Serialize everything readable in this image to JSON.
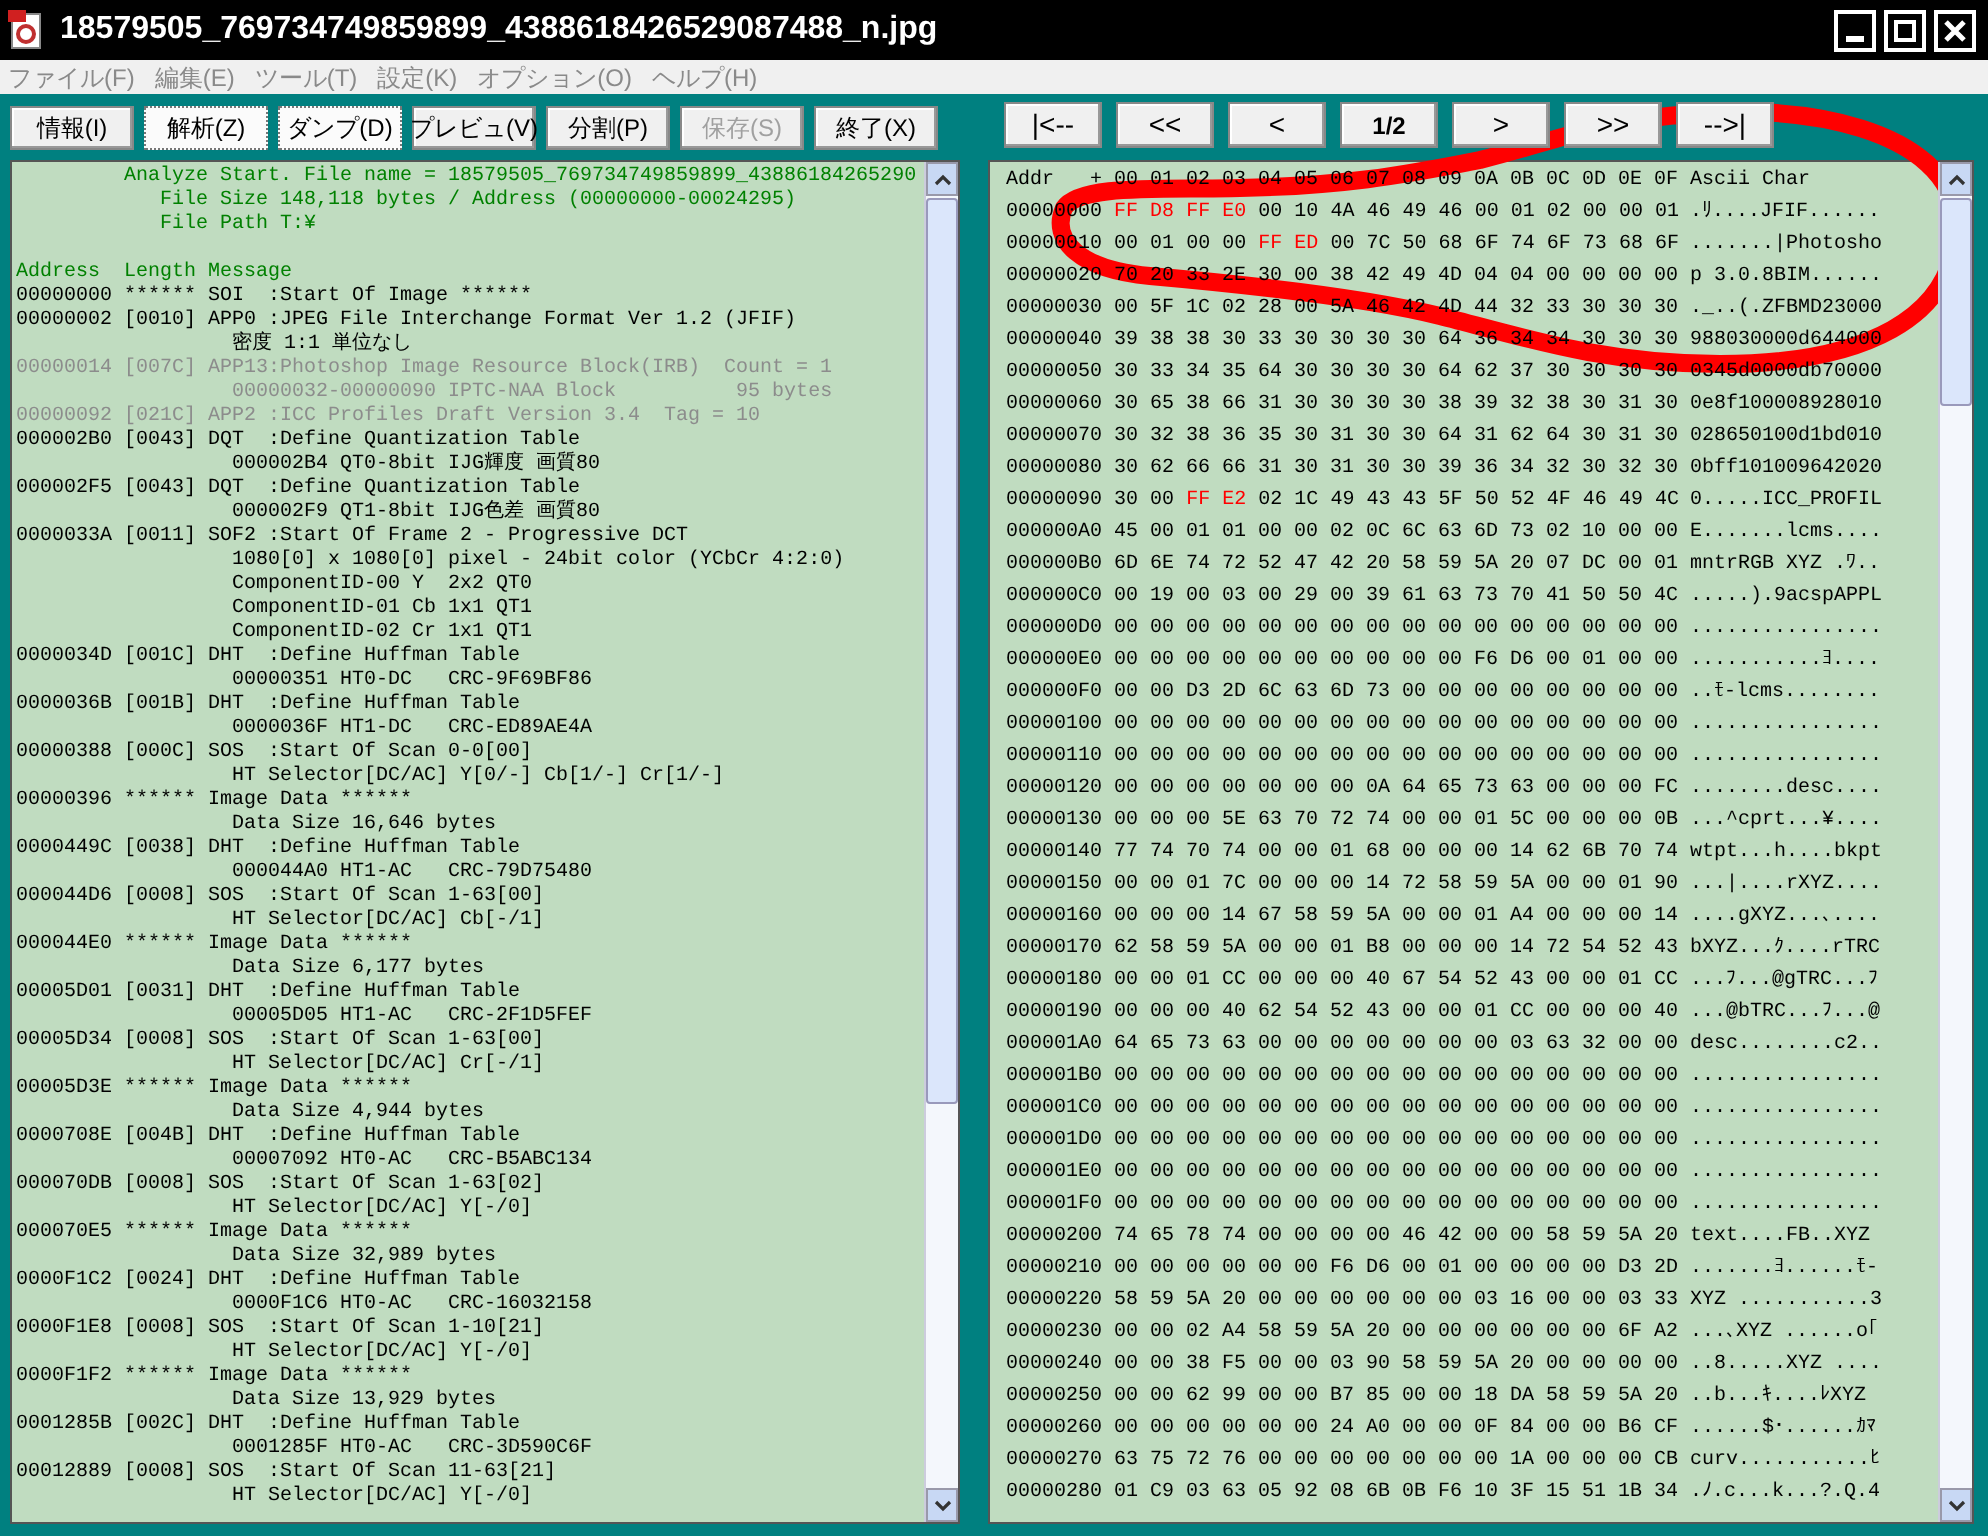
{
  "window": {
    "title": "18579505_769734749859899_4388618426529087488_n.jpg"
  },
  "menu": [
    "ファイル(F)",
    "編集(E)",
    "ツール(T)",
    "設定(K)",
    "オプション(O)",
    "ヘルプ(H)"
  ],
  "toolbar": [
    {
      "label": "情報(I)",
      "selected": false,
      "disabled": false
    },
    {
      "label": "解析(Z)",
      "selected": true,
      "disabled": false
    },
    {
      "label": "ダンプ(D)",
      "selected": true,
      "disabled": false
    },
    {
      "label": "プレビュ(V)",
      "selected": false,
      "disabled": false
    },
    {
      "label": "分割(P)",
      "selected": false,
      "disabled": false
    },
    {
      "label": "保存(S)",
      "selected": false,
      "disabled": true
    },
    {
      "label": "終了(X)",
      "selected": false,
      "disabled": false
    }
  ],
  "navigation": [
    {
      "label": "|<--",
      "kind": "nav"
    },
    {
      "label": "<<",
      "kind": "nav"
    },
    {
      "label": "<",
      "kind": "nav"
    },
    {
      "label": "1/2",
      "kind": "page"
    },
    {
      "label": ">",
      "kind": "nav"
    },
    {
      "label": ">>",
      "kind": "nav"
    },
    {
      "label": "-->|",
      "kind": "nav"
    }
  ],
  "analysis": {
    "header": [
      {
        "kind": "title",
        "text": "Analyze Start. File name = 18579505_769734749859899_43886184265290"
      },
      {
        "kind": "sub",
        "text": "File Size 148,118 bytes / Address (00000000-00024295)"
      },
      {
        "kind": "sub",
        "text": "File Path T:¥"
      }
    ],
    "columns": [
      "Address",
      "Length",
      "Message"
    ],
    "entries": [
      {
        "address": "00000000",
        "length": "******",
        "message": "SOI  :Start Of Image ******",
        "muted": false
      },
      {
        "address": "00000002",
        "length": "[0010]",
        "message": "APP0 :JPEG File Interchange Format Ver 1.2 (JFIF)",
        "muted": false,
        "details": [
          "密度 1:1 単位なし"
        ]
      },
      {
        "address": "00000014",
        "length": "[007C]",
        "message": "APP13:Photoshop Image Resource Block(IRB)  Count = 1",
        "muted": true,
        "details": [
          "00000032-00000090 IPTC-NAA Block          95 bytes"
        ]
      },
      {
        "address": "00000092",
        "length": "[021C]",
        "message": "APP2 :ICC Profiles Draft Version 3.4  Tag = 10",
        "muted": true
      },
      {
        "address": "000002B0",
        "length": "[0043]",
        "message": "DQT  :Define Quantization Table",
        "muted": false,
        "details": [
          "000002B4 QT0-8bit IJG輝度 画質80"
        ]
      },
      {
        "address": "000002F5",
        "length": "[0043]",
        "message": "DQT  :Define Quantization Table",
        "muted": false,
        "details": [
          "000002F9 QT1-8bit IJG色差 画質80"
        ]
      },
      {
        "address": "0000033A",
        "length": "[0011]",
        "message": "SOF2 :Start Of Frame 2 - Progressive DCT",
        "muted": false,
        "details": [
          "1080[0] x 1080[0] pixel - 24bit color (YCbCr 4:2:0)",
          "ComponentID-00 Y  2x2 QT0",
          "ComponentID-01 Cb 1x1 QT1",
          "ComponentID-02 Cr 1x1 QT1"
        ]
      },
      {
        "address": "0000034D",
        "length": "[001C]",
        "message": "DHT  :Define Huffman Table",
        "muted": false,
        "details": [
          "00000351 HT0-DC   CRC-9F69BF86"
        ]
      },
      {
        "address": "0000036B",
        "length": "[001B]",
        "message": "DHT  :Define Huffman Table",
        "muted": false,
        "details": [
          "0000036F HT1-DC   CRC-ED89AE4A"
        ]
      },
      {
        "address": "00000388",
        "length": "[000C]",
        "message": "SOS  :Start Of Scan 0-0[00]",
        "muted": false,
        "details": [
          "HT Selector[DC/AC] Y[0/-] Cb[1/-] Cr[1/-]"
        ]
      },
      {
        "address": "00000396",
        "length": "******",
        "message": "Image Data ******",
        "muted": false,
        "details": [
          "Data Size 16,646 bytes"
        ]
      },
      {
        "address": "0000449C",
        "length": "[0038]",
        "message": "DHT  :Define Huffman Table",
        "muted": false,
        "details": [
          "000044A0 HT1-AC   CRC-79D75480"
        ]
      },
      {
        "address": "000044D6",
        "length": "[0008]",
        "message": "SOS  :Start Of Scan 1-63[00]",
        "muted": false,
        "details": [
          "HT Selector[DC/AC] Cb[-/1]"
        ]
      },
      {
        "address": "000044E0",
        "length": "******",
        "message": "Image Data ******",
        "muted": false,
        "details": [
          "Data Size 6,177 bytes"
        ]
      },
      {
        "address": "00005D01",
        "length": "[0031]",
        "message": "DHT  :Define Huffman Table",
        "muted": false,
        "details": [
          "00005D05 HT1-AC   CRC-2F1D5FEF"
        ]
      },
      {
        "address": "00005D34",
        "length": "[0008]",
        "message": "SOS  :Start Of Scan 1-63[00]",
        "muted": false,
        "details": [
          "HT Selector[DC/AC] Cr[-/1]"
        ]
      },
      {
        "address": "00005D3E",
        "length": "******",
        "message": "Image Data ******",
        "muted": false,
        "details": [
          "Data Size 4,944 bytes"
        ]
      },
      {
        "address": "0000708E",
        "length": "[004B]",
        "message": "DHT  :Define Huffman Table",
        "muted": false,
        "details": [
          "00007092 HT0-AC   CRC-B5ABC134"
        ]
      },
      {
        "address": "000070DB",
        "length": "[0008]",
        "message": "SOS  :Start Of Scan 1-63[02]",
        "muted": false,
        "details": [
          "HT Selector[DC/AC] Y[-/0]"
        ]
      },
      {
        "address": "000070E5",
        "length": "******",
        "message": "Image Data ******",
        "muted": false,
        "details": [
          "Data Size 32,989 bytes"
        ]
      },
      {
        "address": "0000F1C2",
        "length": "[0024]",
        "message": "DHT  :Define Huffman Table",
        "muted": false,
        "details": [
          "0000F1C6 HT0-AC   CRC-16032158"
        ]
      },
      {
        "address": "0000F1E8",
        "length": "[0008]",
        "message": "SOS  :Start Of Scan 1-10[21]",
        "muted": false,
        "details": [
          "HT Selector[DC/AC] Y[-/0]"
        ]
      },
      {
        "address": "0000F1F2",
        "length": "******",
        "message": "Image Data ******",
        "muted": false,
        "details": [
          "Data Size 13,929 bytes"
        ]
      },
      {
        "address": "0001285B",
        "length": "[002C]",
        "message": "DHT  :Define Huffman Table",
        "muted": false,
        "details": [
          "0001285F HT0-AC   CRC-3D590C6F"
        ]
      },
      {
        "address": "00012889",
        "length": "[0008]",
        "message": "SOS  :Start Of Scan 11-63[21]",
        "muted": false,
        "details": [
          "HT Selector[DC/AC] Y[-/0]"
        ]
      }
    ]
  },
  "hex": {
    "header": {
      "addr": "Addr",
      "offset": "+",
      "columns": "00 01 02 03 04 05 06 07 08 09 0A 0B 0C 0D 0E 0F",
      "ascii": "Ascii Char"
    },
    "rows": [
      {
        "addr": "00000000",
        "bytes": "FF D8 FF E0 00 10 4A 46 49 46 00 01 02 00 00 01",
        "ascii": ".ﾘ....JFIF......",
        "marked": [
          true,
          true,
          true,
          true,
          false,
          false,
          false,
          false,
          false,
          false,
          false,
          false,
          false,
          false,
          false,
          false
        ]
      },
      {
        "addr": "00000010",
        "bytes": "00 01 00 00 FF ED 00 7C 50 68 6F 74 6F 73 68 6F",
        "ascii": ".......|Photosho",
        "marked": [
          false,
          false,
          false,
          false,
          true,
          true,
          false,
          false,
          false,
          false,
          false,
          false,
          false,
          false,
          false,
          false
        ]
      },
      {
        "addr": "00000020",
        "bytes": "70 20 33 2E 30 00 38 42 49 4D 04 04 00 00 00 00",
        "ascii": "p 3.0.8BIM......"
      },
      {
        "addr": "00000030",
        "bytes": "00 5F 1C 02 28 00 5A 46 42 4D 44 32 33 30 30 30",
        "ascii": "._..(.ZFBMD23000"
      },
      {
        "addr": "00000040",
        "bytes": "39 38 38 30 33 30 30 30 30 64 36 34 34 30 30 30",
        "ascii": "988030000d644000"
      },
      {
        "addr": "00000050",
        "bytes": "30 33 34 35 64 30 30 30 30 64 62 37 30 30 30 30",
        "ascii": "0345d0000db70000"
      },
      {
        "addr": "00000060",
        "bytes": "30 65 38 66 31 30 30 30 30 38 39 32 38 30 31 30",
        "ascii": "0e8f100008928010"
      },
      {
        "addr": "00000070",
        "bytes": "30 32 38 36 35 30 31 30 30 64 31 62 64 30 31 30",
        "ascii": "028650100d1bd010"
      },
      {
        "addr": "00000080",
        "bytes": "30 62 66 66 31 30 31 30 30 39 36 34 32 30 32 30",
        "ascii": "0bff101009642020"
      },
      {
        "addr": "00000090",
        "bytes": "30 00 FF E2 02 1C 49 43 43 5F 50 52 4F 46 49 4C",
        "ascii": "0.....ICC_PROFIL",
        "marked": [
          false,
          false,
          true,
          true,
          false,
          false,
          false,
          false,
          false,
          false,
          false,
          false,
          false,
          false,
          false,
          false
        ]
      },
      {
        "addr": "000000A0",
        "bytes": "45 00 01 01 00 00 02 0C 6C 63 6D 73 02 10 00 00",
        "ascii": "E.......lcms...."
      },
      {
        "addr": "000000B0",
        "bytes": "6D 6E 74 72 52 47 42 20 58 59 5A 20 07 DC 00 01",
        "ascii": "mntrRGB XYZ .ﾜ.."
      },
      {
        "addr": "000000C0",
        "bytes": "00 19 00 03 00 29 00 39 61 63 73 70 41 50 50 4C",
        "ascii": ".....).9acspAPPL"
      },
      {
        "addr": "000000D0",
        "bytes": "00 00 00 00 00 00 00 00 00 00 00 00 00 00 00 00",
        "ascii": "................"
      },
      {
        "addr": "000000E0",
        "bytes": "00 00 00 00 00 00 00 00 00 00 F6 D6 00 01 00 00",
        "ascii": "...........ﾖ...."
      },
      {
        "addr": "000000F0",
        "bytes": "00 00 D3 2D 6C 63 6D 73 00 00 00 00 00 00 00 00",
        "ascii": "..ﾓ-lcms........"
      },
      {
        "addr": "00000100",
        "bytes": "00 00 00 00 00 00 00 00 00 00 00 00 00 00 00 00",
        "ascii": "................"
      },
      {
        "addr": "00000110",
        "bytes": "00 00 00 00 00 00 00 00 00 00 00 00 00 00 00 00",
        "ascii": "................"
      },
      {
        "addr": "00000120",
        "bytes": "00 00 00 00 00 00 00 0A 64 65 73 63 00 00 00 FC",
        "ascii": "........desc...."
      },
      {
        "addr": "00000130",
        "bytes": "00 00 00 5E 63 70 72 74 00 00 01 5C 00 00 00 0B",
        "ascii": "...^cprt...¥...."
      },
      {
        "addr": "00000140",
        "bytes": "77 74 70 74 00 00 01 68 00 00 00 14 62 6B 70 74",
        "ascii": "wtpt...h....bkpt"
      },
      {
        "addr": "00000150",
        "bytes": "00 00 01 7C 00 00 00 14 72 58 59 5A 00 00 01 90",
        "ascii": "...|....rXYZ...."
      },
      {
        "addr": "00000160",
        "bytes": "00 00 00 14 67 58 59 5A 00 00 01 A4 00 00 00 14",
        "ascii": "....gXYZ...､...."
      },
      {
        "addr": "00000170",
        "bytes": "62 58 59 5A 00 00 01 B8 00 00 00 14 72 54 52 43",
        "ascii": "bXYZ...ｸ....rTRC"
      },
      {
        "addr": "00000180",
        "bytes": "00 00 01 CC 00 00 00 40 67 54 52 43 00 00 01 CC",
        "ascii": "...ﾌ...@gTRC...ﾌ"
      },
      {
        "addr": "00000190",
        "bytes": "00 00 00 40 62 54 52 43 00 00 01 CC 00 00 00 40",
        "ascii": "...@bTRC...ﾌ...@"
      },
      {
        "addr": "000001A0",
        "bytes": "64 65 73 63 00 00 00 00 00 00 00 03 63 32 00 00",
        "ascii": "desc........c2.."
      },
      {
        "addr": "000001B0",
        "bytes": "00 00 00 00 00 00 00 00 00 00 00 00 00 00 00 00",
        "ascii": "................"
      },
      {
        "addr": "000001C0",
        "bytes": "00 00 00 00 00 00 00 00 00 00 00 00 00 00 00 00",
        "ascii": "................"
      },
      {
        "addr": "000001D0",
        "bytes": "00 00 00 00 00 00 00 00 00 00 00 00 00 00 00 00",
        "ascii": "................"
      },
      {
        "addr": "000001E0",
        "bytes": "00 00 00 00 00 00 00 00 00 00 00 00 00 00 00 00",
        "ascii": "................"
      },
      {
        "addr": "000001F0",
        "bytes": "00 00 00 00 00 00 00 00 00 00 00 00 00 00 00 00",
        "ascii": "................"
      },
      {
        "addr": "00000200",
        "bytes": "74 65 78 74 00 00 00 00 46 42 00 00 58 59 5A 20",
        "ascii": "text....FB..XYZ"
      },
      {
        "addr": "00000210",
        "bytes": "00 00 00 00 00 00 F6 D6 00 01 00 00 00 00 D3 2D",
        "ascii": ".......ﾖ......ﾓ-"
      },
      {
        "addr": "00000220",
        "bytes": "58 59 5A 20 00 00 00 00 00 00 03 16 00 00 03 33",
        "ascii": "XYZ ...........3"
      },
      {
        "addr": "00000230",
        "bytes": "00 00 02 A4 58 59 5A 20 00 00 00 00 00 00 6F A2",
        "ascii": "...､XYZ ......o｢"
      },
      {
        "addr": "00000240",
        "bytes": "00 00 38 F5 00 00 03 90 58 59 5A 20 00 00 00 00",
        "ascii": "..8.....XYZ ...."
      },
      {
        "addr": "00000250",
        "bytes": "00 00 62 99 00 00 B7 85 00 00 18 DA 58 59 5A 20",
        "ascii": "..b...ｷ....ﾚXYZ"
      },
      {
        "addr": "00000260",
        "bytes": "00 00 00 00 00 00 24 A0 00 00 0F 84 00 00 B6 CF",
        "ascii": "......$･......ｶﾏ"
      },
      {
        "addr": "00000270",
        "bytes": "63 75 72 76 00 00 00 00 00 00 00 1A 00 00 00 CB",
        "ascii": "curv...........ﾋ"
      },
      {
        "addr": "00000280",
        "bytes": "01 C9 03 63 05 92 08 6B 0B F6 10 3F 15 51 1B 34",
        "ascii": ".ﾉ.c...k...?.Q.4"
      }
    ]
  },
  "markup": [
    {
      "kind": "loop"
    }
  ]
}
